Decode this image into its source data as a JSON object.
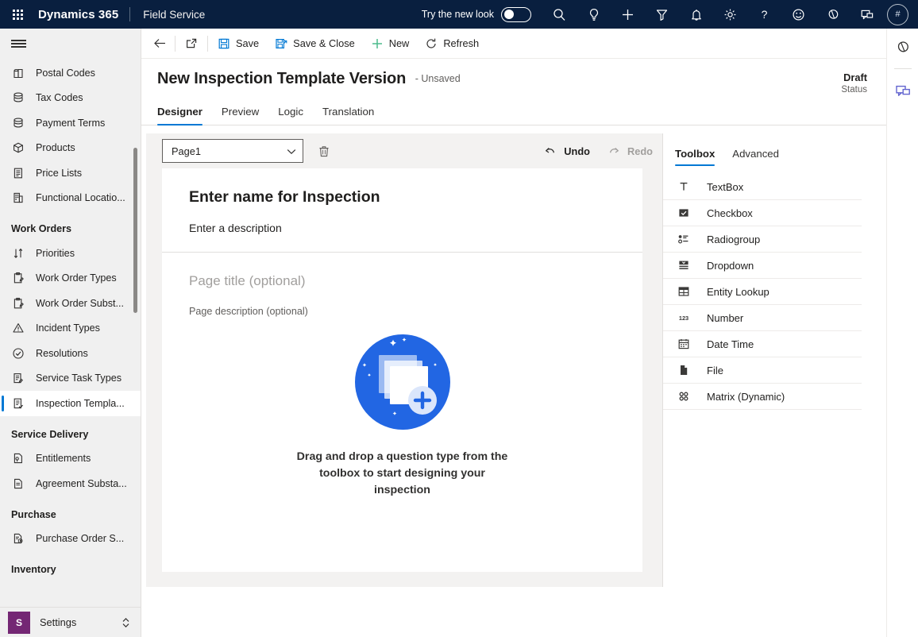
{
  "topnav": {
    "waffle_label": "app-launcher",
    "brand": "Dynamics 365",
    "app_name": "Field Service",
    "new_look_label": "Try the new look",
    "new_look_state": "off",
    "icons": [
      "search-icon",
      "lightbulb-icon",
      "plus-icon",
      "filter-icon",
      "bell-icon",
      "gear-icon",
      "help-icon",
      "smiley-icon",
      "copilot-icon",
      "feedback-icon"
    ],
    "avatar_initials": "#",
    "background": "#091F3F"
  },
  "sidebar": {
    "items": [
      {
        "label": "Postal Codes",
        "icon": "postal-code-icon",
        "selected": false
      },
      {
        "label": "Tax Codes",
        "icon": "stack-icon",
        "selected": false
      },
      {
        "label": "Payment Terms",
        "icon": "stack-icon",
        "selected": false
      },
      {
        "label": "Products",
        "icon": "box-icon",
        "selected": false
      },
      {
        "label": "Price Lists",
        "icon": "document-list-icon",
        "selected": false
      },
      {
        "label": "Functional Locatio...",
        "icon": "building-icon",
        "selected": false
      }
    ],
    "groups": [
      {
        "title": "Work Orders",
        "items": [
          {
            "label": "Priorities",
            "icon": "sort-icon",
            "selected": false
          },
          {
            "label": "Work Order Types",
            "icon": "clipboard-icon",
            "selected": false
          },
          {
            "label": "Work Order Subst...",
            "icon": "clipboard-icon",
            "selected": false
          },
          {
            "label": "Incident Types",
            "icon": "warning-icon",
            "selected": false
          },
          {
            "label": "Resolutions",
            "icon": "check-circle-icon",
            "selected": false
          },
          {
            "label": "Service Task Types",
            "icon": "task-icon",
            "selected": false
          },
          {
            "label": "Inspection Templa...",
            "icon": "inspection-icon",
            "selected": true
          }
        ]
      },
      {
        "title": "Service Delivery",
        "items": [
          {
            "label": "Entitlements",
            "icon": "entitlement-icon",
            "selected": false
          },
          {
            "label": "Agreement Substa...",
            "icon": "agreement-icon",
            "selected": false
          }
        ]
      },
      {
        "title": "Purchase",
        "items": [
          {
            "label": "Purchase Order S...",
            "icon": "purchase-order-icon",
            "selected": false
          }
        ]
      },
      {
        "title": "Inventory",
        "items": []
      }
    ],
    "settings": {
      "badge": "S",
      "label": "Settings",
      "badge_color": "#742774"
    },
    "accent": "#0078d4"
  },
  "commandbar": {
    "back_label": "back-arrow",
    "popout_label": "open-in-new-window",
    "buttons": [
      {
        "label": "Save",
        "icon": "save-icon"
      },
      {
        "label": "Save & Close",
        "icon": "save-close-icon"
      },
      {
        "label": "New",
        "icon": "plus-icon"
      },
      {
        "label": "Refresh",
        "icon": "refresh-icon"
      }
    ]
  },
  "record": {
    "title": "New Inspection Template Version",
    "unsaved_suffix": "- Unsaved",
    "status_value": "Draft",
    "status_label": "Status"
  },
  "tabs": [
    {
      "label": "Designer",
      "active": true
    },
    {
      "label": "Preview",
      "active": false
    },
    {
      "label": "Logic",
      "active": false
    },
    {
      "label": "Translation",
      "active": false
    }
  ],
  "designer": {
    "page_select_value": "Page1",
    "delete_label": "delete-page",
    "undo_label": "Undo",
    "redo_label": "Redo",
    "inspection_name_placeholder": "Enter name for Inspection",
    "inspection_description_placeholder": "Enter a description",
    "page_title_placeholder": "Page title (optional)",
    "page_description_placeholder": "Page description (optional)",
    "empty_state_text": "Drag and drop a question type from the toolbox to start designing your inspection",
    "illustration_color": "#2266E3"
  },
  "toolbox": {
    "tabs": [
      {
        "label": "Toolbox",
        "active": true
      },
      {
        "label": "Advanced",
        "active": false
      }
    ],
    "items": [
      {
        "label": "TextBox",
        "icon": "textbox-icon"
      },
      {
        "label": "Checkbox",
        "icon": "checkbox-icon"
      },
      {
        "label": "Radiogroup",
        "icon": "radiogroup-icon"
      },
      {
        "label": "Dropdown",
        "icon": "dropdown-icon"
      },
      {
        "label": "Entity Lookup",
        "icon": "entity-lookup-icon"
      },
      {
        "label": "Number",
        "icon": "number-icon"
      },
      {
        "label": "Date Time",
        "icon": "calendar-icon"
      },
      {
        "label": "File",
        "icon": "file-icon"
      },
      {
        "label": "Matrix (Dynamic)",
        "icon": "matrix-icon"
      }
    ]
  },
  "rightrail": {
    "items": [
      {
        "icon": "copilot-icon"
      },
      {
        "icon": "feedback-icon"
      }
    ]
  }
}
